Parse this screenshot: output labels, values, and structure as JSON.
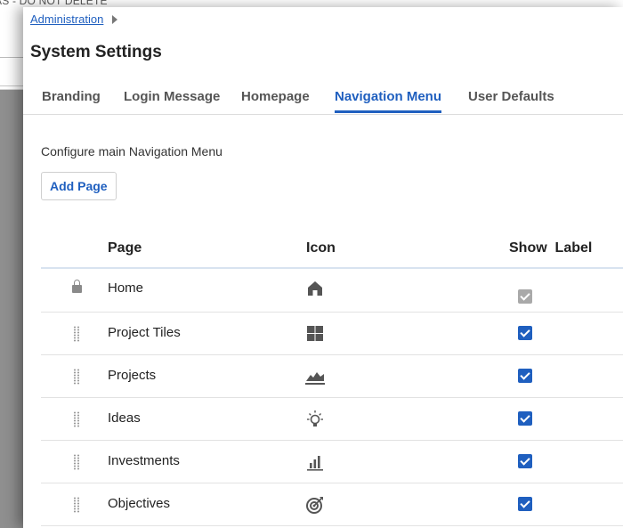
{
  "background_window": {
    "title": "AS - DO NOT DELETE"
  },
  "breadcrumb": {
    "label": "Administration"
  },
  "page": {
    "title": "System Settings"
  },
  "tabs": [
    {
      "label": "Branding"
    },
    {
      "label": "Login Message"
    },
    {
      "label": "Homepage"
    },
    {
      "label": "Navigation Menu",
      "active": true
    },
    {
      "label": "User Defaults"
    }
  ],
  "section": {
    "description": "Configure main Navigation Menu",
    "add_button": "Add Page"
  },
  "table": {
    "headers": {
      "page": "Page",
      "icon": "Icon",
      "show_label": "Show  Label"
    },
    "rows": [
      {
        "page": "Home",
        "icon": "home-icon",
        "locked": true,
        "show_label": true,
        "checkbox_disabled": true
      },
      {
        "page": "Project Tiles",
        "icon": "grid-tiles-icon",
        "locked": false,
        "show_label": true
      },
      {
        "page": "Projects",
        "icon": "mountain-chart-icon",
        "locked": false,
        "show_label": true
      },
      {
        "page": "Ideas",
        "icon": "lightbulb-icon",
        "locked": false,
        "show_label": true
      },
      {
        "page": "Investments",
        "icon": "bar-chart-icon",
        "locked": false,
        "show_label": true
      },
      {
        "page": "Objectives",
        "icon": "target-icon",
        "locked": false,
        "show_label": true
      }
    ]
  },
  "colors": {
    "accent": "#1f5fbf",
    "icon_gray": "#555555",
    "disabled_check": "#a9a9a9"
  }
}
